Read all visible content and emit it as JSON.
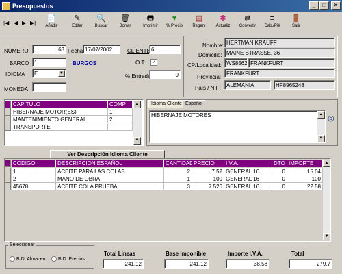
{
  "window": {
    "title": "Presupuestos"
  },
  "toolbar": {
    "buttons": [
      {
        "label": "Añadir",
        "icon": "📄"
      },
      {
        "label": "Editar",
        "icon": "✎"
      },
      {
        "label": "Buscar",
        "icon": "🔍"
      },
      {
        "label": "Borrar",
        "icon": "🗑"
      },
      {
        "label": "Imprimir",
        "icon": "🖶"
      },
      {
        "label": "% Precio",
        "icon": "♥"
      },
      {
        "label": "Regen.",
        "icon": "▤"
      },
      {
        "label": "Actualiz",
        "icon": "✱"
      },
      {
        "label": "Convertir",
        "icon": "⇄"
      },
      {
        "label": "Cab./Pié",
        "icon": "≡"
      },
      {
        "label": "Salir",
        "icon": "🚪"
      }
    ]
  },
  "header": {
    "numero_label": "NUMERO",
    "numero": "63",
    "fecha_label": "Fecha",
    "fecha": "17/07/2002",
    "cliente_label": "CLIENTE",
    "cliente": "6",
    "barco_label": "BARCO",
    "barco": "1",
    "barco_name": "BURGOS",
    "idioma_label": "IDIOMA",
    "idioma": "E",
    "ot_label": "O.T.",
    "ot_check": "✓",
    "entrada_label": "% Entrada",
    "entrada": "0",
    "moneda_label": "MONEDA",
    "moneda": ""
  },
  "client": {
    "nombre_label": "Nombre:",
    "nombre": "HERTMAN KRAUFF",
    "domicilio_label": "Domicilio:",
    "domicilio": "MAINE STRASSE, 36",
    "cp_label": "CP/Localidad:",
    "cp": "WS8562",
    "localidad": "FRANKFURT",
    "provincia_label": "Provincia:",
    "provincia": "FRANKFURT",
    "pais_label": "País / NIF:",
    "pais": "ALEMANIA",
    "nif": "HF8965248"
  },
  "capitulos": {
    "headers": [
      "CAPITULO",
      "COMP"
    ],
    "rows": [
      {
        "name": "HIBERNAJE MOTOR(ES)",
        "comp": "1"
      },
      {
        "name": "MANTENIMIENTO GENERAL",
        "comp": "2"
      },
      {
        "name": "TRANSPORTE",
        "comp": ""
      }
    ]
  },
  "desc_tabs": {
    "tab1": "Idioma Cliente",
    "tab2": "Español",
    "text": "HIBERNAJE MOTORES"
  },
  "lines": {
    "button": "Ver Descripción Idioma Cliente",
    "headers": [
      "CODIGO",
      "DESCRIPCION ESPAÑOL",
      "CANTIDAD",
      "PRECIO",
      "I.V.A.",
      "DTO",
      "IMPORTE"
    ],
    "rows": [
      [
        "1",
        "ACEITE PARA LAS COLAS",
        "2",
        "7.52",
        "GENERAL 16",
        "0",
        "15.04"
      ],
      [
        "2",
        "MANO DE OBRA",
        "1",
        "100",
        "GENERAL 16",
        "0",
        "100"
      ],
      [
        "45678",
        "ACEITE COLA PRUEBA",
        "3",
        "7.526",
        "GENERAL 16",
        "0",
        "22.58"
      ]
    ]
  },
  "select": {
    "label": "Seleccionar",
    "opt1": "B.D. Almacen",
    "opt2": "B.D. Precios"
  },
  "totals": {
    "lineas_label": "Total Lineas",
    "lineas": "241.12",
    "base_label": "Base Imponible",
    "base": "241.12",
    "iva_label": "Importe I.V.A.",
    "iva": "38.58",
    "total_label": "Total",
    "total": "279.7"
  }
}
